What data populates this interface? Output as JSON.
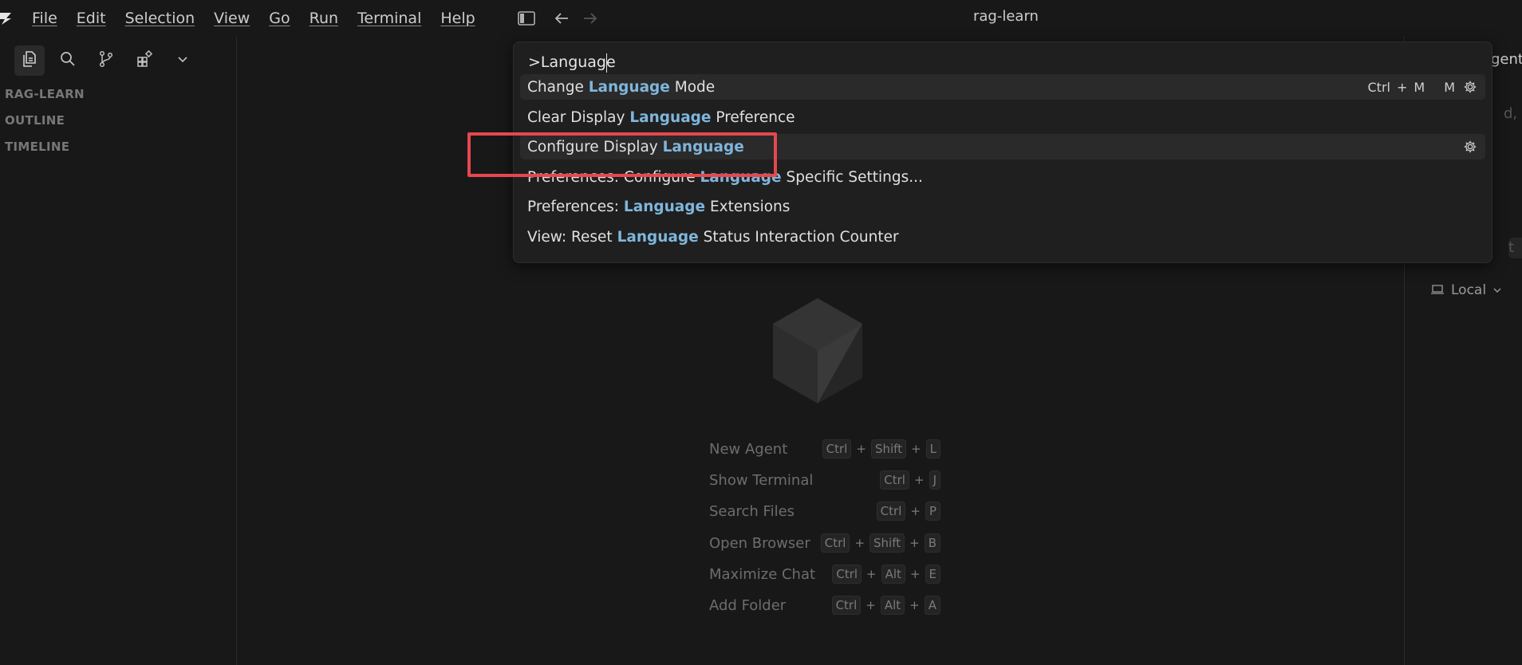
{
  "titlebar": {
    "menu": [
      "File",
      "Edit",
      "Selection",
      "View",
      "Go",
      "Run",
      "Terminal",
      "Help"
    ],
    "window_title": "rag-learn"
  },
  "sidebar": {
    "tabs": [
      "explorer-icon",
      "search-icon",
      "source-control-icon",
      "extensions-icon",
      "chevron-down-icon"
    ],
    "sections": [
      "RAG-LEARN",
      "OUTLINE",
      "TIMELINE"
    ]
  },
  "command_palette": {
    "input_value": ">Language",
    "items": [
      {
        "before": "Change ",
        "match": "Language",
        "after": " Mode",
        "keys": [
          "Ctrl",
          "+",
          "M",
          "M"
        ],
        "gear": true,
        "highlighted": true
      },
      {
        "before": "Clear Display ",
        "match": "Language",
        "after": " Preference",
        "keys": [],
        "gear": false,
        "highlighted": false
      },
      {
        "before": "Configure Display ",
        "match": "Language",
        "after": "",
        "keys": [],
        "gear": true,
        "highlighted": true
      },
      {
        "before": "Preferences: Configure ",
        "match": "Language",
        "after": " Specific Settings...",
        "keys": [],
        "gear": false,
        "highlighted": false
      },
      {
        "before": "Preferences: ",
        "match": "Language",
        "after": " Extensions",
        "keys": [],
        "gear": false,
        "highlighted": false
      },
      {
        "before": "View: Reset ",
        "match": "Language",
        "after": " Status Interaction Counter",
        "keys": [],
        "gear": false,
        "highlighted": false
      }
    ]
  },
  "editor": {
    "shortcuts": [
      {
        "label": "New Agent",
        "keys": [
          "Ctrl",
          "Shift",
          "L"
        ]
      },
      {
        "label": "Show Terminal",
        "keys": [
          "Ctrl",
          "J"
        ]
      },
      {
        "label": "Search Files",
        "keys": [
          "Ctrl",
          "P"
        ]
      },
      {
        "label": "Open Browser",
        "keys": [
          "Ctrl",
          "Shift",
          "B"
        ]
      },
      {
        "label": "Maximize Chat",
        "keys": [
          "Ctrl",
          "Alt",
          "E"
        ]
      },
      {
        "label": "Add Folder",
        "keys": [
          "Ctrl",
          "Alt",
          "A"
        ]
      }
    ]
  },
  "right_panel": {
    "title_partial": "gent",
    "placeholder_partial": "d, / f",
    "dropdown_partial": "t",
    "local_label": "Local"
  },
  "colors": {
    "background": "#181818",
    "palette_bg": "#1f1f1f",
    "highlight_match": "#7fb6dc",
    "annotation_red": "#e5484d"
  }
}
